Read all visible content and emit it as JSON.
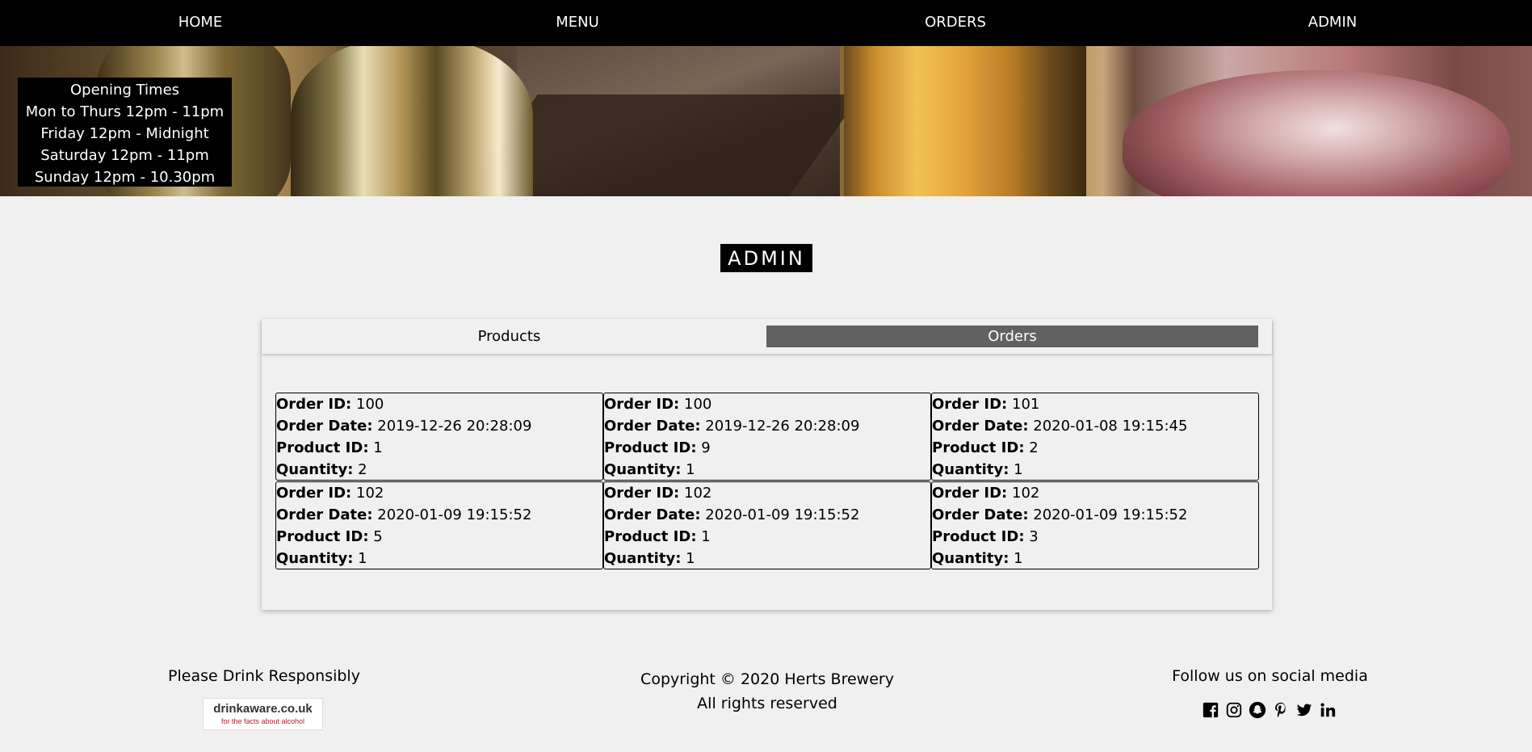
{
  "nav": {
    "items": [
      "HOME",
      "MENU",
      "ORDERS",
      "ADMIN"
    ]
  },
  "hours": {
    "title": "Opening Times",
    "lines": [
      "Mon to Thurs 12pm - 11pm",
      "Friday 12pm - Midnight",
      "Saturday 12pm - 11pm",
      "Sunday 12pm - 10.30pm"
    ]
  },
  "page_title": "ADMIN",
  "tabs": {
    "products": "Products",
    "orders": "Orders",
    "active": "Orders"
  },
  "labels": {
    "order_id": "Order ID:",
    "order_date": "Order Date:",
    "product_id": "Product ID:",
    "quantity": "Quantity:"
  },
  "orders": [
    {
      "order_id": "100",
      "order_date": "2019-12-26 20:28:09",
      "product_id": "1",
      "quantity": "2"
    },
    {
      "order_id": "100",
      "order_date": "2019-12-26 20:28:09",
      "product_id": "9",
      "quantity": "1"
    },
    {
      "order_id": "101",
      "order_date": "2020-01-08 19:15:45",
      "product_id": "2",
      "quantity": "1"
    },
    {
      "order_id": "102",
      "order_date": "2020-01-09 19:15:52",
      "product_id": "5",
      "quantity": "1"
    },
    {
      "order_id": "102",
      "order_date": "2020-01-09 19:15:52",
      "product_id": "1",
      "quantity": "1"
    },
    {
      "order_id": "102",
      "order_date": "2020-01-09 19:15:52",
      "product_id": "3",
      "quantity": "1"
    }
  ],
  "footer": {
    "left": "Please Drink Responsibly",
    "drinkaware_main": "drinkaware.co.uk",
    "drinkaware_sub": "for the facts about alcohol",
    "copyright": "Copyright © 2020 Herts Brewery",
    "rights": "All rights reserved",
    "social_title": "Follow us on social media",
    "social_icons": [
      "facebook-icon",
      "instagram-icon",
      "snapchat-icon",
      "pinterest-icon",
      "twitter-icon",
      "linkedin-icon"
    ]
  }
}
